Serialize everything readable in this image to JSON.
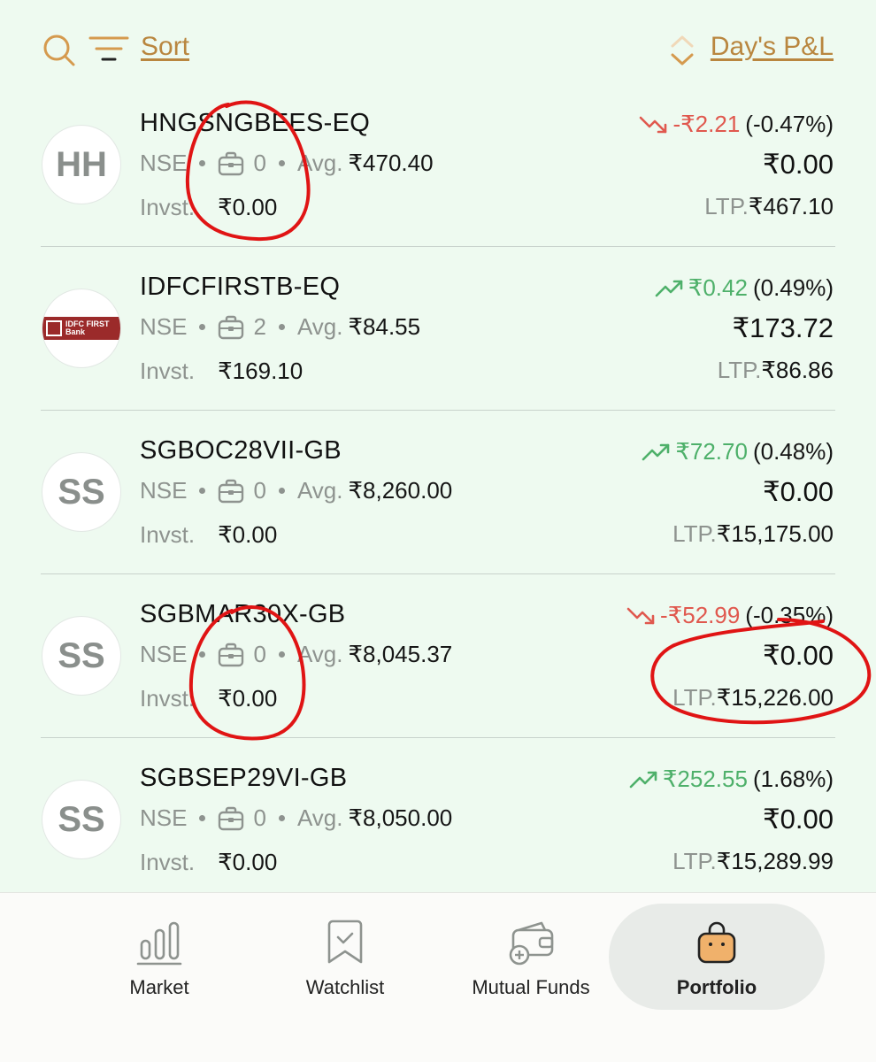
{
  "toolbar": {
    "sort_label": "Sort",
    "pnl_label": "Day's P&L"
  },
  "holdings": [
    {
      "avatar": "HH",
      "symbol": "HNGSNGBEES-EQ",
      "exchange": "NSE",
      "qty": "0",
      "avg_label": "Avg.",
      "avg": "₹470.40",
      "inv_label": "Invst.",
      "invested": "₹0.00",
      "change": "-₹2.21",
      "change_pct": "(-0.47%)",
      "direction": "down",
      "current": "₹0.00",
      "ltp_label": "LTP.",
      "ltp": "₹467.10"
    },
    {
      "avatar": "",
      "logo_text": "IDFC FIRST Bank",
      "symbol": "IDFCFIRSTB-EQ",
      "exchange": "NSE",
      "qty": "2",
      "avg_label": "Avg.",
      "avg": "₹84.55",
      "inv_label": "Invst.",
      "invested": "₹169.10",
      "change": "₹0.42",
      "change_pct": "(0.49%)",
      "direction": "up",
      "current": "₹173.72",
      "ltp_label": "LTP.",
      "ltp": "₹86.86"
    },
    {
      "avatar": "SS",
      "symbol": "SGBOC28VII-GB",
      "exchange": "NSE",
      "qty": "0",
      "avg_label": "Avg.",
      "avg": "₹8,260.00",
      "inv_label": "Invst.",
      "invested": "₹0.00",
      "change": "₹72.70",
      "change_pct": "(0.48%)",
      "direction": "up",
      "current": "₹0.00",
      "ltp_label": "LTP.",
      "ltp": "₹15,175.00"
    },
    {
      "avatar": "SS",
      "symbol": "SGBMAR30X-GB",
      "exchange": "NSE",
      "qty": "0",
      "avg_label": "Avg.",
      "avg": "₹8,045.37",
      "inv_label": "Invst.",
      "invested": "₹0.00",
      "change": "-₹52.99",
      "change_pct": "(-0.35%)",
      "direction": "down",
      "current": "₹0.00",
      "ltp_label": "LTP.",
      "ltp": "₹15,226.00"
    },
    {
      "avatar": "SS",
      "symbol": "SGBSEP29VI-GB",
      "exchange": "NSE",
      "qty": "0",
      "avg_label": "Avg.",
      "avg": "₹8,050.00",
      "inv_label": "Invst.",
      "invested": "₹0.00",
      "change": "₹252.55",
      "change_pct": "(1.68%)",
      "direction": "up",
      "current": "₹0.00",
      "ltp_label": "LTP.",
      "ltp": "₹15,289.99"
    }
  ],
  "nav": {
    "market": "Market",
    "watchlist": "Watchlist",
    "mutual_funds": "Mutual Funds",
    "portfolio": "Portfolio",
    "active": "portfolio"
  },
  "colors": {
    "background": "#eefaf0",
    "accent": "#b9863f",
    "loss": "#e0584e",
    "gain": "#4eb06a",
    "annotation": "#e01414"
  },
  "icons": {
    "search": "search-icon",
    "filter": "filter-icon",
    "sort_toggle": "updown-icon",
    "quantity": "briefcase-icon",
    "market": "bar-chart-icon",
    "watchlist": "bookmark-check-icon",
    "mutual_funds": "wallet-plus-icon",
    "portfolio": "shopping-bag-icon"
  }
}
